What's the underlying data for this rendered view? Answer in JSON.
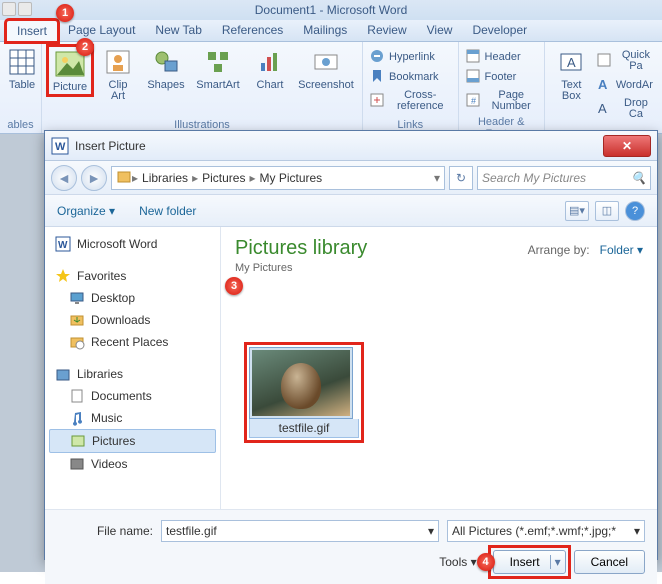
{
  "app": {
    "title": "Document1 - Microsoft Word"
  },
  "tabs": {
    "insert": "Insert",
    "pagelayout": "Page Layout",
    "newtab": "New Tab",
    "references": "References",
    "mailings": "Mailings",
    "review": "Review",
    "view": "View",
    "developer": "Developer"
  },
  "ribbon": {
    "tables": {
      "table": "Table",
      "group": "ables"
    },
    "illustrations": {
      "picture": "Picture",
      "clipart": "Clip\nArt",
      "shapes": "Shapes",
      "smartart": "SmartArt",
      "chart": "Chart",
      "screenshot": "Screenshot",
      "group": "Illustrations"
    },
    "links": {
      "hyperlink": "Hyperlink",
      "bookmark": "Bookmark",
      "crossref": "Cross-reference",
      "group": "Links"
    },
    "headerfooter": {
      "header": "Header",
      "footer": "Footer",
      "pagenum": "Page Number",
      "group": "Header & Footer"
    },
    "text": {
      "textbox": "Text\nBox",
      "quickpa": "Quick Pa",
      "wordart": "WordAr",
      "dropca": "Drop Ca"
    }
  },
  "dialog": {
    "title": "Insert Picture",
    "crumbs": {
      "lib_icon": "Libraries",
      "libraries": "Libraries",
      "pictures": "Pictures",
      "mypictures": "My Pictures"
    },
    "search_placeholder": "Search My Pictures",
    "toolbar": {
      "organize": "Organize",
      "newfolder": "New folder"
    },
    "sidebar": {
      "msword": "Microsoft Word",
      "favorites": "Favorites",
      "desktop": "Desktop",
      "downloads": "Downloads",
      "recent": "Recent Places",
      "libraries": "Libraries",
      "documents": "Documents",
      "music": "Music",
      "pictures": "Pictures",
      "videos": "Videos"
    },
    "content": {
      "title": "Pictures library",
      "subtitle": "My Pictures",
      "arrange_label": "Arrange by:",
      "arrange_value": "Folder",
      "file_caption": "testfile.gif"
    },
    "footer": {
      "filename_label": "File name:",
      "filename_value": "testfile.gif",
      "filter": "All Pictures (*.emf;*.wmf;*.jpg;*",
      "tools": "Tools",
      "insert": "Insert",
      "cancel": "Cancel"
    }
  },
  "markers": {
    "m1": "1",
    "m2": "2",
    "m3": "3",
    "m4": "4"
  }
}
